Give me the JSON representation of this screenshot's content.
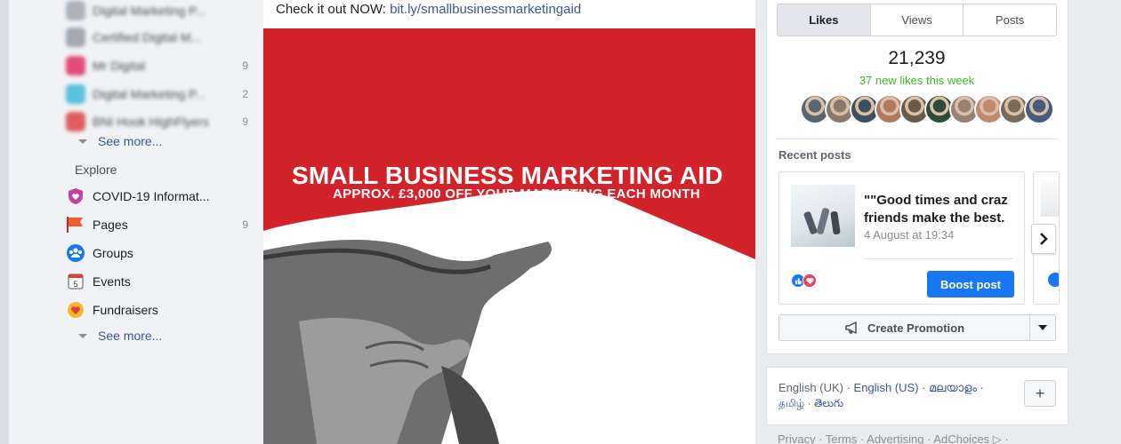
{
  "sidebar": {
    "shortcuts": [
      {
        "label": "Digital Marketing P...",
        "count": "",
        "color": "#9aa3ab"
      },
      {
        "label": "Certified Digital M...",
        "count": "",
        "color": "#8f98a0"
      },
      {
        "label": "Mr Digital",
        "count": "9",
        "color": "#e0245e"
      },
      {
        "label": "Digital Marketing P...",
        "count": "2",
        "color": "#37b6d6"
      },
      {
        "label": "BNI Hook HighFlyers",
        "count": "9",
        "color": "#d93a3a"
      }
    ],
    "see_more_1": "See more...",
    "explore_heading": "Explore",
    "explore": [
      {
        "label": "COVID-19 Informat...",
        "count": "",
        "icon": "heart-shield-icon",
        "color": "#c1439b"
      },
      {
        "label": "Pages",
        "count": "9",
        "icon": "flag-icon",
        "color": "#f25c2a"
      },
      {
        "label": "Groups",
        "count": "",
        "icon": "groups-icon",
        "color": "#1877f2"
      },
      {
        "label": "Events",
        "count": "",
        "icon": "calendar-icon",
        "color": "#e03e3e"
      },
      {
        "label": "Fundraisers",
        "count": "",
        "icon": "fundraiser-heart-icon",
        "color": "#f7b928"
      }
    ],
    "see_more_2": "See more..."
  },
  "post": {
    "text_prefix": "Check it out NOW: ",
    "link": "bit.ly/smallbusinessmarketingaid",
    "image_title": "SMALL BUSINESS MARKETING AID",
    "image_subtitle": "APPROX. £3,000 OFF YOUR MARKETING EACH MONTH",
    "image_bg": "#d2232a"
  },
  "insights": {
    "tabs": [
      "Likes",
      "Views",
      "Posts"
    ],
    "active_tab": "Likes",
    "likes_count": "21,239",
    "likes_week": "37 new likes this week",
    "avatar_colors": [
      "#5a6570",
      "#8a7a6a",
      "#3f4f5f",
      "#b07a60",
      "#6a5a4a",
      "#2f4a3a",
      "#9a8070",
      "#c08a70",
      "#7a6a5a",
      "#4a5a7a"
    ]
  },
  "recent_posts": {
    "heading": "Recent posts",
    "items": [
      {
        "title": "\"\"Good times and craz",
        "title_line2": "friends make the best.",
        "date": "4 August at 19:34",
        "boost_label": "Boost post"
      }
    ]
  },
  "promotion": {
    "label": "Create Promotion"
  },
  "languages": {
    "current": "English (UK)",
    "sep": " · ",
    "options_line1": [
      "English (US)",
      "മലയാളം"
    ],
    "options_line2": [
      "தமிழ்",
      "తెలుగు"
    ],
    "add_label": "+"
  },
  "footer": {
    "links": "Privacy · Terms · Advertising · AdChoices ▷ ·"
  }
}
